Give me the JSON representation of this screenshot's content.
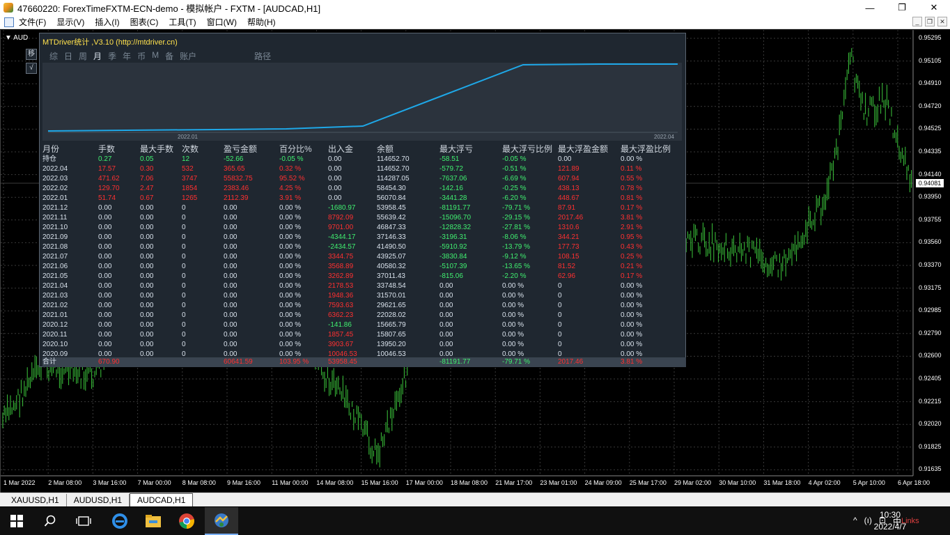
{
  "window": {
    "title": "47660220: ForexTimeFXTM-ECN-demo - 模拟帐户 - FXTM - [AUDCAD,H1]",
    "minimize": "—",
    "maximize": "❐",
    "close": "✕"
  },
  "menu": {
    "items": [
      "文件(F)",
      "显示(V)",
      "插入(I)",
      "图表(C)",
      "工具(T)",
      "窗口(W)",
      "帮助(H)"
    ]
  },
  "chart": {
    "symbol": "AUD",
    "current_price": "0.94081",
    "price_labels": [
      "0.95295",
      "0.95105",
      "0.94910",
      "0.94720",
      "0.94525",
      "0.94335",
      "0.94140",
      "0.93950",
      "0.93755",
      "0.93560",
      "0.93370",
      "0.93175",
      "0.92985",
      "0.92790",
      "0.92600",
      "0.92405",
      "0.92215",
      "0.92020",
      "0.91825",
      "0.91635"
    ],
    "time_labels": [
      "1 Mar 2022",
      "2 Mar 08:00",
      "3 Mar 16:00",
      "7 Mar 00:00",
      "8 Mar 08:00",
      "9 Mar 16:00",
      "11 Mar 00:00",
      "14 Mar 08:00",
      "15 Mar 16:00",
      "17 Mar 00:00",
      "18 Mar 08:00",
      "21 Mar 17:00",
      "23 Mar 01:00",
      "24 Mar 09:00",
      "25 Mar 17:00",
      "29 Mar 02:00",
      "30 Mar 10:00",
      "31 Mar 18:00",
      "4 Apr 02:00",
      "5 Apr 10:00",
      "6 Apr 18:00"
    ],
    "bar_color": "#3cc83c",
    "grid_color": "#3a3a3a"
  },
  "panel": {
    "title": "MTDriver统计 ,V3.10 (http://mtdriver.cn)",
    "side_buttons": [
      "移",
      "√"
    ],
    "tabs": [
      "综",
      "日",
      "周",
      "月",
      "季",
      "年",
      "币",
      "M",
      "备",
      "账户",
      "路径"
    ],
    "active_tab": "月",
    "mini_chart": {
      "date_left": "2022.01",
      "date_right": "2022.04",
      "line_color": "#1ea8e8"
    },
    "columns": [
      "月份",
      "手数",
      "最大手数",
      "次数",
      "盈亏金额",
      "百分比%",
      "出入金",
      "余额",
      "最大浮亏",
      "最大浮亏比例",
      "最大浮盈金额",
      "最大浮盈比例"
    ],
    "rows": [
      {
        "c": [
          "持仓",
          "0.27",
          "0.05",
          "12",
          "-52.66",
          "-0.05 %",
          "0.00",
          "114652.70",
          "-58.51",
          "-0.05 %",
          "0.00",
          "0.00 %"
        ],
        "s": [
          "w",
          "g",
          "g",
          "g",
          "g",
          "g",
          "w",
          "w",
          "g",
          "g",
          "w",
          "w"
        ]
      },
      {
        "c": [
          "2022.04",
          "17.57",
          "0.30",
          "532",
          "365.65",
          "0.32 %",
          "0.00",
          "114652.70",
          "-579.72",
          "-0.51 %",
          "121.89",
          "0.11 %"
        ],
        "s": [
          "w",
          "r",
          "r",
          "r",
          "r",
          "r",
          "w",
          "w",
          "g",
          "g",
          "r",
          "r"
        ]
      },
      {
        "c": [
          "2022.03",
          "471.62",
          "7.06",
          "3747",
          "55832.75",
          "95.52 %",
          "0.00",
          "114287.05",
          "-7637.06",
          "-6.69 %",
          "607.94",
          "0.55 %"
        ],
        "s": [
          "w",
          "r",
          "r",
          "r",
          "r",
          "r",
          "w",
          "w",
          "g",
          "g",
          "r",
          "r"
        ]
      },
      {
        "c": [
          "2022.02",
          "129.70",
          "2.47",
          "1854",
          "2383.46",
          "4.25 %",
          "0.00",
          "58454.30",
          "-142.16",
          "-0.25 %",
          "438.13",
          "0.78 %"
        ],
        "s": [
          "w",
          "r",
          "r",
          "r",
          "r",
          "r",
          "w",
          "w",
          "g",
          "g",
          "r",
          "r"
        ]
      },
      {
        "c": [
          "2022.01",
          "51.74",
          "0.67",
          "1265",
          "2112.39",
          "3.91 %",
          "0.00",
          "56070.84",
          "-3441.28",
          "-6.20 %",
          "448.67",
          "0.81 %"
        ],
        "s": [
          "w",
          "r",
          "r",
          "r",
          "r",
          "r",
          "w",
          "w",
          "g",
          "g",
          "r",
          "r"
        ]
      },
      {
        "c": [
          "2021.12",
          "0.00",
          "0.00",
          "0",
          "0.00",
          "0.00 %",
          "-1680.97",
          "53958.45",
          "-81191.77",
          "-79.71 %",
          "87.91",
          "0.17 %"
        ],
        "s": [
          "w",
          "w",
          "w",
          "w",
          "w",
          "w",
          "g",
          "w",
          "g",
          "g",
          "r",
          "r"
        ]
      },
      {
        "c": [
          "2021.11",
          "0.00",
          "0.00",
          "0",
          "0.00",
          "0.00 %",
          "8792.09",
          "55639.42",
          "-15096.70",
          "-29.15 %",
          "2017.46",
          "3.81 %"
        ],
        "s": [
          "w",
          "w",
          "w",
          "w",
          "w",
          "w",
          "r",
          "w",
          "g",
          "g",
          "r",
          "r"
        ]
      },
      {
        "c": [
          "2021.10",
          "0.00",
          "0.00",
          "0",
          "0.00",
          "0.00 %",
          "9701.00",
          "46847.33",
          "-12828.32",
          "-27.81 %",
          "1310.6",
          "2.91 %"
        ],
        "s": [
          "w",
          "w",
          "w",
          "w",
          "w",
          "w",
          "r",
          "w",
          "g",
          "g",
          "r",
          "r"
        ]
      },
      {
        "c": [
          "2021.09",
          "0.00",
          "0.00",
          "0",
          "0.00",
          "0.00 %",
          "-4344.17",
          "37146.33",
          "-3196.31",
          "-8.06 %",
          "344.21",
          "0.95 %"
        ],
        "s": [
          "w",
          "w",
          "w",
          "w",
          "w",
          "w",
          "g",
          "w",
          "g",
          "g",
          "r",
          "r"
        ]
      },
      {
        "c": [
          "2021.08",
          "0.00",
          "0.00",
          "0",
          "0.00",
          "0.00 %",
          "-2434.57",
          "41490.50",
          "-5910.92",
          "-13.79 %",
          "177.73",
          "0.43 %"
        ],
        "s": [
          "w",
          "w",
          "w",
          "w",
          "w",
          "w",
          "g",
          "w",
          "g",
          "g",
          "r",
          "r"
        ]
      },
      {
        "c": [
          "2021.07",
          "0.00",
          "0.00",
          "0",
          "0.00",
          "0.00 %",
          "3344.75",
          "43925.07",
          "-3830.84",
          "-9.12 %",
          "108.15",
          "0.25 %"
        ],
        "s": [
          "w",
          "w",
          "w",
          "w",
          "w",
          "w",
          "r",
          "w",
          "g",
          "g",
          "r",
          "r"
        ]
      },
      {
        "c": [
          "2021.06",
          "0.00",
          "0.00",
          "0",
          "0.00",
          "0.00 %",
          "3568.89",
          "40580.32",
          "-5107.39",
          "-13.65 %",
          "81.52",
          "0.21 %"
        ],
        "s": [
          "w",
          "w",
          "w",
          "w",
          "w",
          "w",
          "r",
          "w",
          "g",
          "g",
          "r",
          "r"
        ]
      },
      {
        "c": [
          "2021.05",
          "0.00",
          "0.00",
          "0",
          "0.00",
          "0.00 %",
          "3262.89",
          "37011.43",
          "-815.06",
          "-2.20 %",
          "62.96",
          "0.17 %"
        ],
        "s": [
          "w",
          "w",
          "w",
          "w",
          "w",
          "w",
          "r",
          "w",
          "g",
          "g",
          "r",
          "r"
        ]
      },
      {
        "c": [
          "2021.04",
          "0.00",
          "0.00",
          "0",
          "0.00",
          "0.00 %",
          "2178.53",
          "33748.54",
          "0.00",
          "0.00 %",
          "0",
          "0.00 %"
        ],
        "s": [
          "w",
          "w",
          "w",
          "w",
          "w",
          "w",
          "r",
          "w",
          "w",
          "w",
          "w",
          "w"
        ]
      },
      {
        "c": [
          "2021.03",
          "0.00",
          "0.00",
          "0",
          "0.00",
          "0.00 %",
          "1948.36",
          "31570.01",
          "0.00",
          "0.00 %",
          "0",
          "0.00 %"
        ],
        "s": [
          "w",
          "w",
          "w",
          "w",
          "w",
          "w",
          "r",
          "w",
          "w",
          "w",
          "w",
          "w"
        ]
      },
      {
        "c": [
          "2021.02",
          "0.00",
          "0.00",
          "0",
          "0.00",
          "0.00 %",
          "7593.63",
          "29621.65",
          "0.00",
          "0.00 %",
          "0",
          "0.00 %"
        ],
        "s": [
          "w",
          "w",
          "w",
          "w",
          "w",
          "w",
          "r",
          "w",
          "w",
          "w",
          "w",
          "w"
        ]
      },
      {
        "c": [
          "2021.01",
          "0.00",
          "0.00",
          "0",
          "0.00",
          "0.00 %",
          "6362.23",
          "22028.02",
          "0.00",
          "0.00 %",
          "0",
          "0.00 %"
        ],
        "s": [
          "w",
          "w",
          "w",
          "w",
          "w",
          "w",
          "r",
          "w",
          "w",
          "w",
          "w",
          "w"
        ]
      },
      {
        "c": [
          "2020.12",
          "0.00",
          "0.00",
          "0",
          "0.00",
          "0.00 %",
          "-141.86",
          "15665.79",
          "0.00",
          "0.00 %",
          "0",
          "0.00 %"
        ],
        "s": [
          "w",
          "w",
          "w",
          "w",
          "w",
          "w",
          "g",
          "w",
          "w",
          "w",
          "w",
          "w"
        ]
      },
      {
        "c": [
          "2020.11",
          "0.00",
          "0.00",
          "0",
          "0.00",
          "0.00 %",
          "1857.45",
          "15807.65",
          "0.00",
          "0.00 %",
          "0",
          "0.00 %"
        ],
        "s": [
          "w",
          "w",
          "w",
          "w",
          "w",
          "w",
          "r",
          "w",
          "w",
          "w",
          "w",
          "w"
        ]
      },
      {
        "c": [
          "2020.10",
          "0.00",
          "0.00",
          "0",
          "0.00",
          "0.00 %",
          "3903.67",
          "13950.20",
          "0.00",
          "0.00 %",
          "0",
          "0.00 %"
        ],
        "s": [
          "w",
          "w",
          "w",
          "w",
          "w",
          "w",
          "r",
          "w",
          "w",
          "w",
          "w",
          "w"
        ]
      },
      {
        "c": [
          "2020.09",
          "0.00",
          "0.00",
          "0",
          "0.00",
          "0.00 %",
          "10046.53",
          "10046.53",
          "0.00",
          "0.00 %",
          "0",
          "0.00 %"
        ],
        "s": [
          "w",
          "w",
          "w",
          "w",
          "w",
          "w",
          "r",
          "w",
          "w",
          "w",
          "w",
          "w"
        ]
      }
    ],
    "total": {
      "c": [
        "合计",
        "670.90",
        "",
        "",
        "60641.59",
        "103.95 %",
        "53958.45",
        "",
        "-81191.77",
        "-79.71 %",
        "2017.46",
        "3.81 %"
      ],
      "s": [
        "w",
        "r",
        "r",
        "r",
        "r",
        "r",
        "r",
        "w",
        "g",
        "g",
        "r",
        "r"
      ]
    }
  },
  "chart_tabs": [
    "XAUUSD,H1",
    "AUDUSD,H1",
    "AUDCAD,H1"
  ],
  "active_chart_tab": "AUDCAD,H1",
  "taskbar": {
    "apps": [
      "start-icon",
      "search-icon",
      "task-view-icon",
      "ie-icon",
      "explorer-icon",
      "chrome-icon",
      "mt4-icon"
    ],
    "tray": [
      "^",
      "(ı)",
      "⊡",
      "中"
    ],
    "time": "10:30",
    "date": "2022/4/7",
    "watermark": "Links"
  }
}
